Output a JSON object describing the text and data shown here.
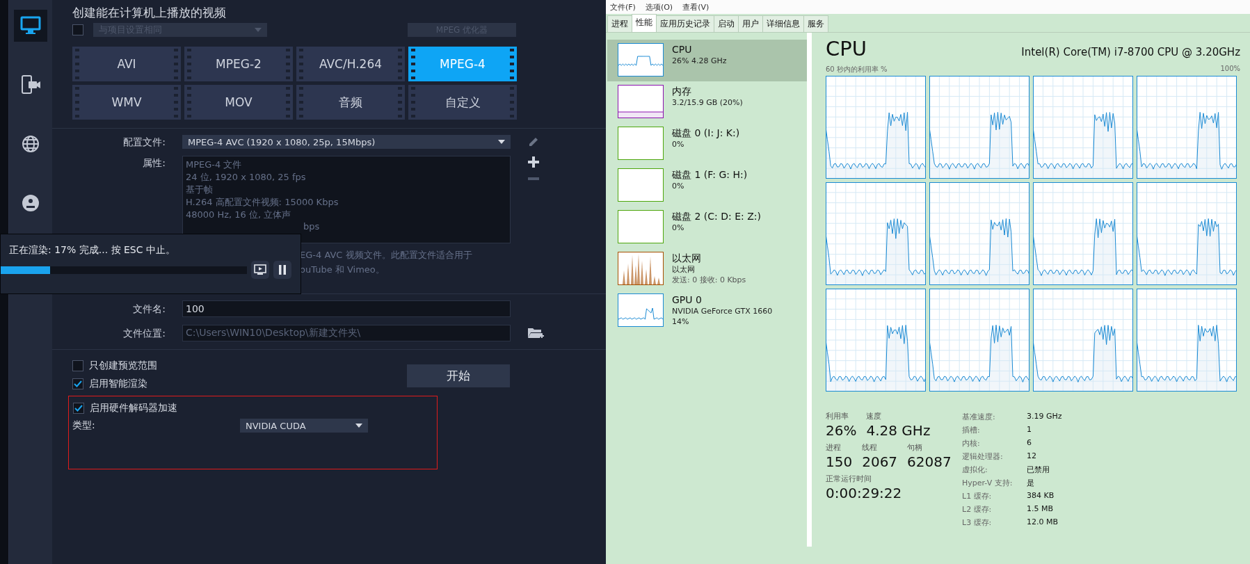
{
  "render_app": {
    "sidebar": [
      {
        "kind": "monitor",
        "selected": true
      },
      {
        "kind": "phone-camera",
        "selected": false
      },
      {
        "kind": "globe",
        "selected": false
      },
      {
        "kind": "disc",
        "selected": false
      }
    ],
    "heading": "创建能在计算机上播放的视频",
    "same_as_project": {
      "label": "与项目设置相同",
      "checked": false,
      "disabled": true
    },
    "optimizer_button": {
      "label": "MPEG 优化器",
      "disabled": true
    },
    "formats": [
      {
        "label": "AVI",
        "selected": false
      },
      {
        "label": "MPEG-2",
        "selected": false
      },
      {
        "label": "AVC/H.264",
        "selected": false
      },
      {
        "label": "MPEG-4",
        "selected": true
      },
      {
        "label": "WMV",
        "selected": false
      },
      {
        "label": "MOV",
        "selected": false
      },
      {
        "label": "音频",
        "selected": false
      },
      {
        "label": "自定义",
        "selected": false
      }
    ],
    "profile": {
      "label": "配置文件:",
      "value": "MPEG-4 AVC (1920 x 1080, 25p, 15Mbps)"
    },
    "properties": {
      "label": "属性:",
      "lines": [
        "MPEG-4 文件",
        "24 位, 1920 x 1080, 25 fps",
        "基于帧",
        "H.264 高配置文件视频: 15000 Kbps",
        "48000 Hz, 16 位, 立体声"
      ],
      "partial_line": "bps"
    },
    "description_lines": [
      "EG-4 AVC 视频文件。此配置文件适合用于",
      "ouTube 和 Vimeo。"
    ],
    "file_name": {
      "label": "文件名:",
      "value": "100"
    },
    "file_location": {
      "label": "文件位置:",
      "value": "C:\\Users\\WIN10\\Desktop\\新建文件夹\\",
      "disabled": true
    },
    "options": [
      {
        "label": "只创建预览范围",
        "checked": false
      },
      {
        "label": "启用智能渲染",
        "checked": true
      },
      {
        "label": "启用硬件解码器加速",
        "checked": true
      }
    ],
    "start_button": "开始",
    "type": {
      "label": "类型:",
      "value": "NVIDIA CUDA"
    },
    "render_dialog": {
      "message": "正在渲染: 17% 完成... 按 ESC 中止。",
      "level": 0.2
    }
  },
  "task_manager": {
    "menu": [
      "文件(F)",
      "选项(O)",
      "查看(V)"
    ],
    "tabs": [
      {
        "label": "进程",
        "selected": false
      },
      {
        "label": "性能",
        "selected": true
      },
      {
        "label": "应用历史记录",
        "selected": false
      },
      {
        "label": "启动",
        "selected": false
      },
      {
        "label": "用户",
        "selected": false
      },
      {
        "label": "详细信息",
        "selected": false
      },
      {
        "label": "服务",
        "selected": false
      }
    ],
    "resources": [
      {
        "name": "CPU",
        "lines": [
          "26% 4.28 GHz"
        ],
        "kind": "line",
        "color": "#1a8ad4",
        "selected": true
      },
      {
        "name": "内存",
        "lines": [
          "3.2/15.9 GB (20%)"
        ],
        "kind": "level",
        "color": "#8b12ae",
        "selected": false
      },
      {
        "name": "磁盘 0 (I: J: K:)",
        "lines": [
          "0%"
        ],
        "kind": "empty",
        "color": "#4da60c",
        "selected": false
      },
      {
        "name": "磁盘 1 (F: G: H:)",
        "lines": [
          "0%"
        ],
        "kind": "empty",
        "color": "#4da60c",
        "selected": false
      },
      {
        "name": "磁盘 2 (C: D: E: Z:)",
        "lines": [
          "0%"
        ],
        "kind": "empty",
        "color": "#4da60c",
        "selected": false
      },
      {
        "name": "以太网",
        "lines": [
          "以太网",
          "发送: 0 接收: 0 Kbps"
        ],
        "kind": "spikes",
        "color": "#a74f01",
        "selected": false
      },
      {
        "name": "GPU 0",
        "lines": [
          "NVIDIA GeForce GTX 1660",
          "14%"
        ],
        "kind": "line",
        "color": "#1a8ad4",
        "selected": false
      }
    ],
    "detail": {
      "title": "CPU",
      "model": "Intel(R) Core(TM) i7-8700 CPU @ 3.20GHz",
      "graph_caption": "60 秒内的利用率 %",
      "graph_max": "100%",
      "stats": [
        [
          {
            "label": "利用率",
            "value": "26%"
          },
          {
            "label": "速度",
            "value": "4.28 GHz"
          }
        ],
        [
          {
            "label": "进程",
            "value": "150"
          },
          {
            "label": "线程",
            "value": "2067"
          },
          {
            "label": "句柄",
            "value": "62087"
          }
        ],
        [
          {
            "label": "正常运行时间",
            "value": "0:00:29:22"
          }
        ]
      ],
      "specs": [
        {
          "label": "基准速度:",
          "value": "3.19 GHz"
        },
        {
          "label": "插槽:",
          "value": "1"
        },
        {
          "label": "内核:",
          "value": "6"
        },
        {
          "label": "逻辑处理器:",
          "value": "12"
        },
        {
          "label": "虚拟化:",
          "value": "已禁用"
        },
        {
          "label": "Hyper-V 支持:",
          "value": "是"
        },
        {
          "label": "L1 缓存:",
          "value": "384 KB"
        },
        {
          "label": "L2 缓存:",
          "value": "1.5 MB"
        },
        {
          "label": "L3 缓存:",
          "value": "12.0 MB"
        }
      ]
    }
  }
}
